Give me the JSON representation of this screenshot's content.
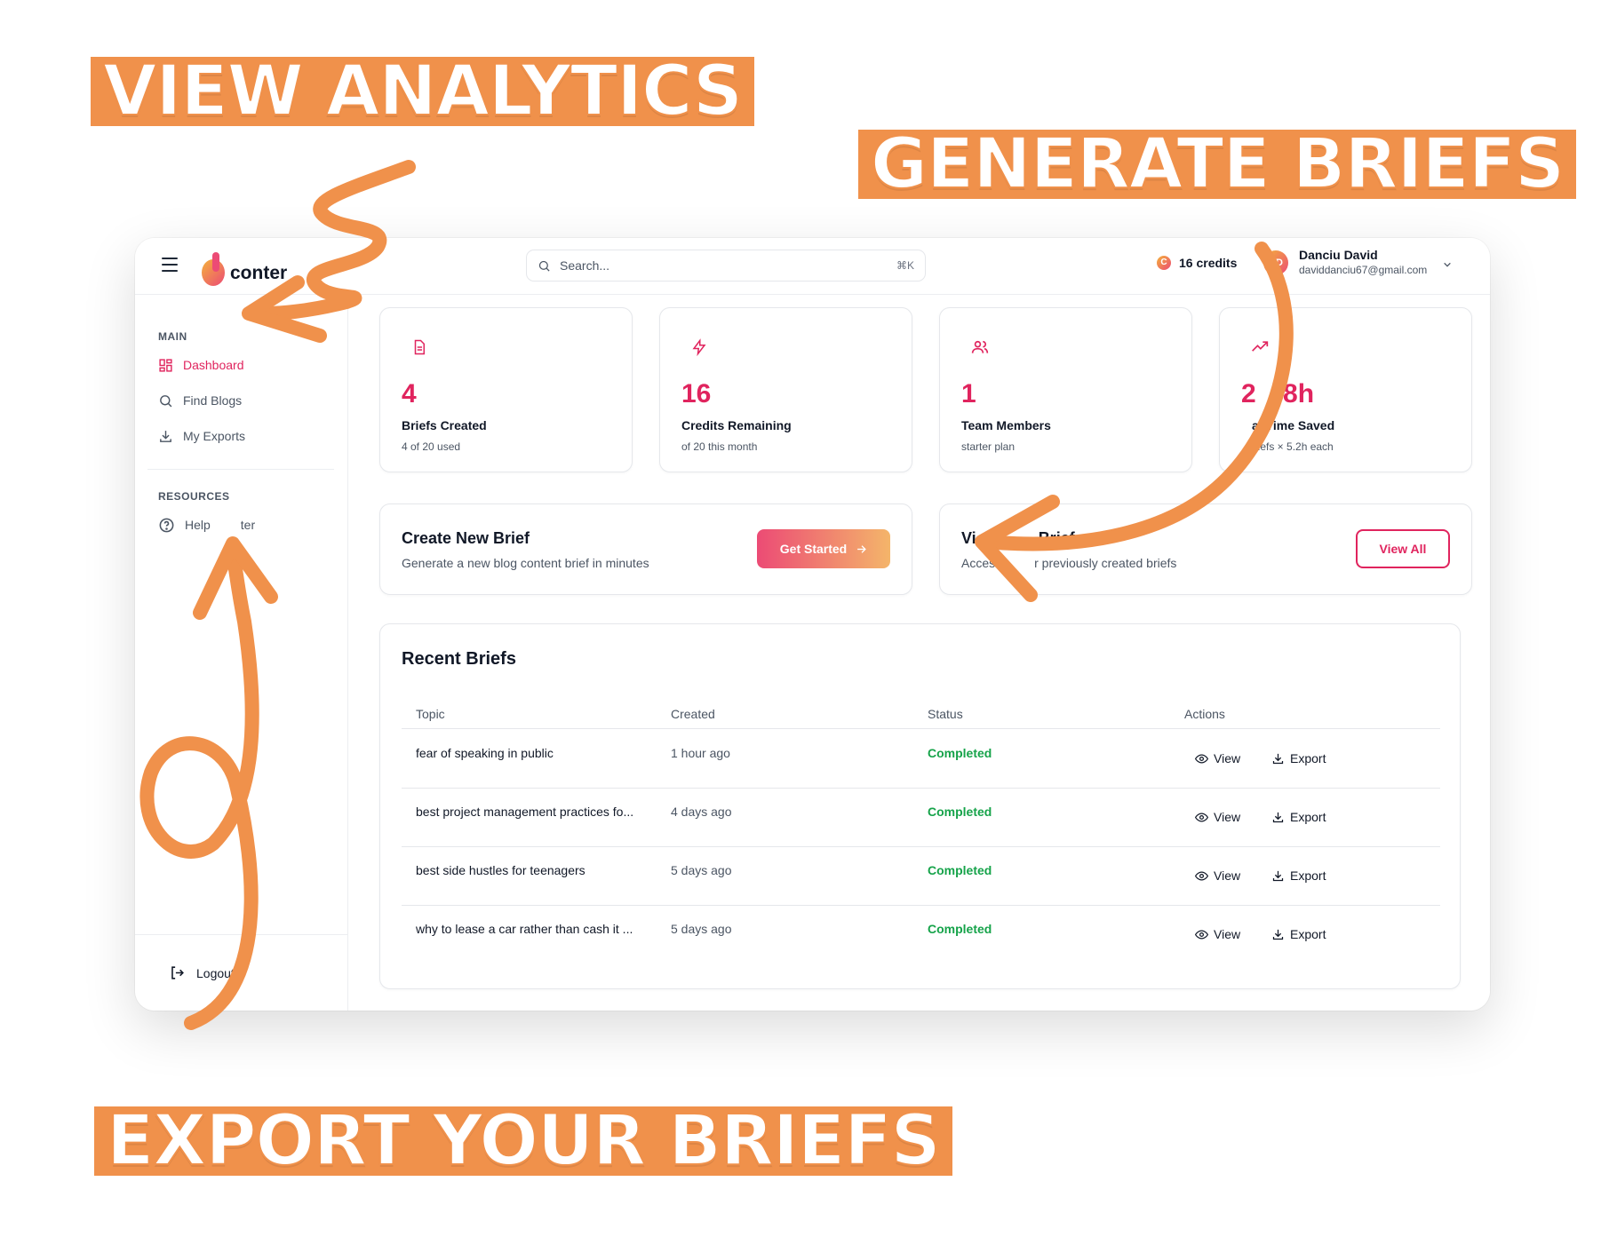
{
  "promo": {
    "view_analytics": "VIEW ANALYTICS",
    "generate_briefs": "GENERATE BRIEFS",
    "export_briefs": "EXPORT YOUR BRIEFS"
  },
  "header": {
    "logo_text": "conter",
    "logo_text_tail": "v",
    "search_placeholder": "Search...",
    "search_shortcut": "⌘K",
    "credits": "16 credits",
    "credits_coin": "C",
    "user_initials": "DD",
    "user_name": "Danciu David",
    "user_email": "daviddanciu67@gmail.com"
  },
  "sidebar": {
    "main_label": "MAIN",
    "items": [
      {
        "label": "Dashboard",
        "icon": "grid-icon",
        "active": true
      },
      {
        "label": "Find Blogs",
        "icon": "search-icon",
        "active": false
      },
      {
        "label": "My Exports",
        "icon": "download-icon",
        "active": false
      }
    ],
    "resources_label": "RESOURCES",
    "resources": [
      {
        "label": "Help",
        "tail": "ter",
        "icon": "help-circle-icon"
      }
    ],
    "logout": "Logout"
  },
  "stats": [
    {
      "icon": "document-icon",
      "value": "4",
      "label": "Briefs Created",
      "sub": "4 of 20 used"
    },
    {
      "icon": "lightning-icon",
      "value": "16",
      "label": "Credits Remaining",
      "sub": "of 20 this month"
    },
    {
      "icon": "users-icon",
      "value": "1",
      "label": "Team Members",
      "sub": "starter plan"
    },
    {
      "icon": "trending-up-icon",
      "value": ".8h",
      "value_head": "2",
      "label": "al Time Saved",
      "sub": "briefs × 5.2h each"
    }
  ],
  "actions": {
    "create": {
      "title": "Create New Brief",
      "desc": "Generate a new blog content brief in minutes",
      "button": "Get Started"
    },
    "view": {
      "title_head": "Vi",
      "title_tail": "Briefs",
      "desc_head": "Acces",
      "desc_tail": "r previously created briefs",
      "button": "View All"
    }
  },
  "recent": {
    "title": "Recent Briefs",
    "columns": [
      "Topic",
      "Created",
      "Status",
      "Actions"
    ],
    "view_label": "View",
    "export_label": "Export",
    "rows": [
      {
        "topic": "fear of speaking in public",
        "created": "1 hour ago",
        "status": "Completed"
      },
      {
        "topic": "best project management practices fo...",
        "created": "4 days ago",
        "status": "Completed"
      },
      {
        "topic": "best side hustles for teenagers",
        "created": "5 days ago",
        "status": "Completed"
      },
      {
        "topic": "why to lease a car rather than cash it ...",
        "created": "5 days ago",
        "status": "Completed"
      }
    ]
  },
  "colors": {
    "accent": "#e0245e",
    "promo_orange": "#f0914b",
    "status_green": "#16a34a"
  }
}
